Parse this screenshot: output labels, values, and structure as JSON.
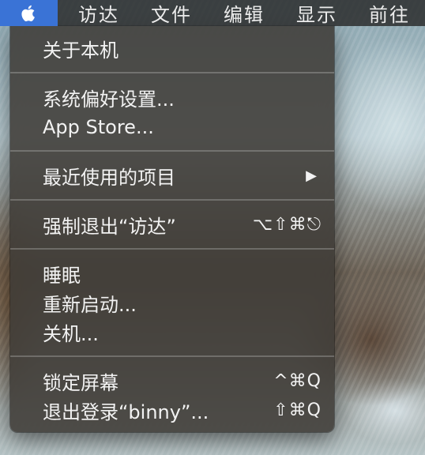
{
  "menubar": {
    "items": [
      {
        "label": "访达"
      },
      {
        "label": "文件"
      },
      {
        "label": "编辑"
      },
      {
        "label": "显示"
      },
      {
        "label": "前往"
      }
    ],
    "apple_color": "#3a73d6"
  },
  "apple_menu": {
    "groups": [
      [
        {
          "label": "关于本机",
          "shortcut": ""
        }
      ],
      [
        {
          "label": "系统偏好设置...",
          "shortcut": ""
        },
        {
          "label": "App Store...",
          "shortcut": ""
        }
      ],
      [
        {
          "label": "最近使用的项目",
          "shortcut": "",
          "submenu": "▶"
        }
      ],
      [
        {
          "label": "强制退出“访达”",
          "shortcut": "⌥⇧⌘⎋"
        }
      ],
      [
        {
          "label": "睡眠",
          "shortcut": ""
        },
        {
          "label": "重新启动...",
          "shortcut": ""
        },
        {
          "label": "关机...",
          "shortcut": ""
        }
      ],
      [
        {
          "label": "锁定屏幕",
          "shortcut": "^⌘Q"
        },
        {
          "label": "退出登录“binny”...",
          "shortcut": "⇧⌘Q"
        }
      ]
    ]
  }
}
